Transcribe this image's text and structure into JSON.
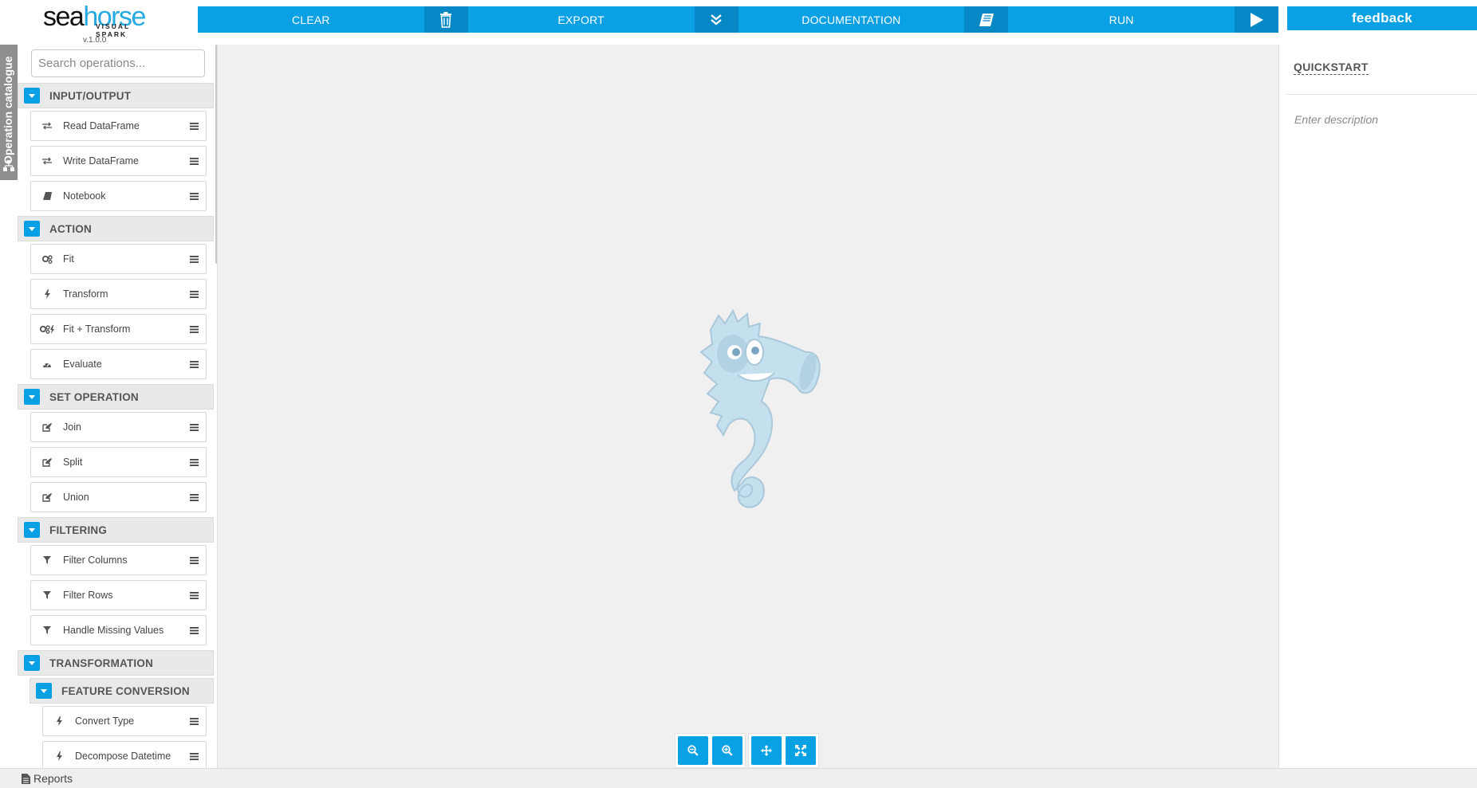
{
  "brand": {
    "logo_prefix": "sea",
    "logo_suffix": "horse",
    "logo_sub": "VISUAL SPARK",
    "version": "v.1.0.0"
  },
  "toolbar": {
    "clear": "CLEAR",
    "export": "EXPORT",
    "documentation": "DOCUMENTATION",
    "run": "RUN"
  },
  "feedback": "feedback",
  "catalogue_tab": "Operation catalogue",
  "search": {
    "placeholder": "Search operations..."
  },
  "catalog": {
    "input_output": {
      "name": "INPUT/OUTPUT",
      "ops": [
        {
          "label": "Read DataFrame",
          "icon": "transfer-icon"
        },
        {
          "label": "Write DataFrame",
          "icon": "transfer-icon"
        },
        {
          "label": "Notebook",
          "icon": "book-icon"
        }
      ]
    },
    "action": {
      "name": "ACTION",
      "ops": [
        {
          "label": "Fit",
          "icon": "gears-icon"
        },
        {
          "label": "Transform",
          "icon": "bolt-icon"
        },
        {
          "label": "Fit + Transform",
          "icon": "gears-bolt-icon"
        },
        {
          "label": "Evaluate",
          "icon": "dashboard-icon"
        }
      ]
    },
    "set_operation": {
      "name": "SET OPERATION",
      "ops": [
        {
          "label": "Join",
          "icon": "edit-icon"
        },
        {
          "label": "Split",
          "icon": "edit-icon"
        },
        {
          "label": "Union",
          "icon": "edit-icon"
        }
      ]
    },
    "filtering": {
      "name": "FILTERING",
      "ops": [
        {
          "label": "Filter Columns",
          "icon": "filter-icon"
        },
        {
          "label": "Filter Rows",
          "icon": "filter-icon"
        },
        {
          "label": "Handle Missing Values",
          "icon": "filter-icon"
        }
      ]
    },
    "transformation": {
      "name": "TRANSFORMATION",
      "feature_conversion": {
        "name": "FEATURE CONVERSION",
        "ops": [
          {
            "label": "Convert Type",
            "icon": "bolt-icon"
          },
          {
            "label": "Decompose Datetime",
            "icon": "bolt-icon"
          }
        ]
      }
    }
  },
  "quickstart": {
    "title": "QUICKSTART",
    "description_placeholder": "Enter description"
  },
  "bottom": {
    "reports": "Reports"
  },
  "colors": {
    "accent": "#0aa0e4",
    "accent_dark": "#0688c7",
    "canvas_bg": "#f0f0f0",
    "category_bg": "#e9e9e9"
  }
}
